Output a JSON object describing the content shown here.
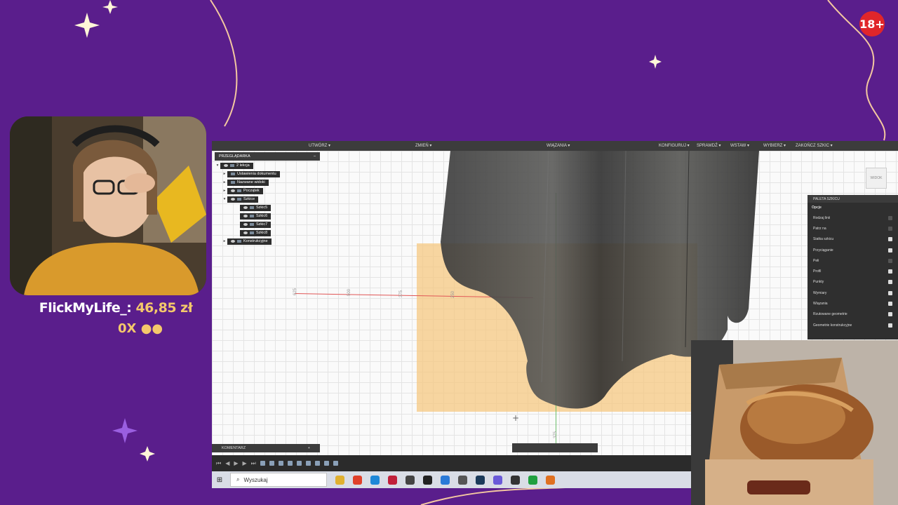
{
  "overlay": {
    "age_badge": "18+",
    "donation_name": "FlickMyLife_:",
    "donation_amount": "46,85 zł",
    "counter": "0X",
    "counter_icon": "people-icon",
    "colors": {
      "background": "#5a1e8c",
      "accent": "#f4c86b",
      "badge": "#e0262a"
    }
  },
  "cad": {
    "toolbar": [
      "UTWÓRZ ▾",
      "ZMIEŃ ▾",
      "WIĄZANIA ▾",
      "KONFIGURUJ ▾",
      "SPRAWDŹ ▾",
      "WSTAW ▾",
      "WYBIERZ ▾",
      "ZAKOŃCZ SZKIC ▾"
    ],
    "browser": {
      "title": "PRZEGLĄDARKA",
      "root": "2 lekcja",
      "items": [
        "Ustawienia dokumentu",
        "Nazwane widoki",
        "Początek",
        "Szkice",
        "Konstrukcyjne"
      ],
      "sketches": [
        "Szkic5",
        "Szkic6",
        "Szkic7",
        "Szkic8"
      ]
    },
    "rulers": [
      "625",
      "500",
      "375",
      "250",
      "375"
    ],
    "viewcube": "WIDOK",
    "palette": {
      "title": "PALETA SZKICU",
      "section": "Opcje",
      "rows": [
        {
          "label": "Rodzaj linii",
          "checked": false
        },
        {
          "label": "Patrz na",
          "checked": false
        },
        {
          "label": "Siatka szkicu",
          "checked": true
        },
        {
          "label": "Przyciąganie",
          "checked": true
        },
        {
          "label": "Pełi",
          "checked": false
        },
        {
          "label": "Profil",
          "checked": true
        },
        {
          "label": "Punkty",
          "checked": true
        },
        {
          "label": "Wymiary",
          "checked": true
        },
        {
          "label": "Wiązania",
          "checked": true
        },
        {
          "label": "Rzutowane geometrie",
          "checked": true
        },
        {
          "label": "Geometrie konstrukcyjne",
          "checked": true
        }
      ]
    },
    "comment_bar": "KOMENTARZ",
    "comment_plus": "+"
  },
  "taskbar": {
    "search_placeholder": "Wyszukaj"
  }
}
